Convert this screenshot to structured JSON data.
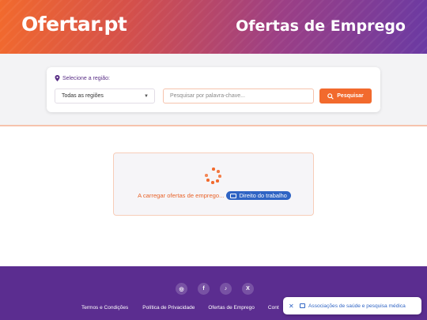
{
  "header": {
    "logo": "Ofertar.pt",
    "title": "Ofertas de Emprego"
  },
  "search": {
    "region_label": "Selecione a região:",
    "region_selected": "Todas as regiões",
    "keyword_placeholder": "Pesquisar por palavra-chave...",
    "button_label": "Pesquisar"
  },
  "loading": {
    "text": "A carregar ofertas de emprego...",
    "tag": "Direito do trabalho"
  },
  "footer": {
    "social": [
      {
        "icon": "instagram-icon",
        "glyph": "◎"
      },
      {
        "icon": "facebook-icon",
        "glyph": "f"
      },
      {
        "icon": "tiktok-icon",
        "glyph": "♪"
      },
      {
        "icon": "x-icon",
        "glyph": "X"
      }
    ],
    "links": [
      "Termos e Condições",
      "Política de Privacidade",
      "Ofertas de Emprego",
      "Cont"
    ]
  },
  "toast": {
    "text": "Associações de saúde e pesquisa médica"
  },
  "colors": {
    "accent": "#f26a2d",
    "brand_purple": "#5b2d90",
    "tag_blue": "#2f64c4"
  }
}
